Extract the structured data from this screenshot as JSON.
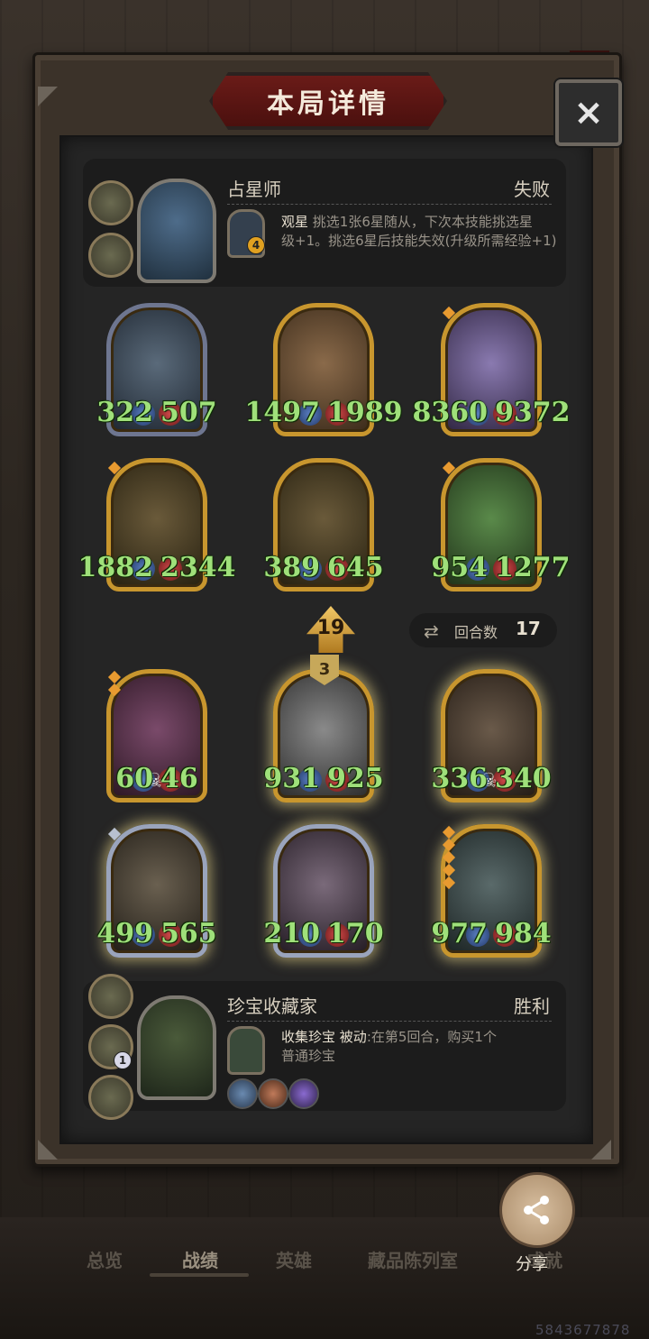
{
  "title": "本局详情",
  "close_icon": "×",
  "top_player": {
    "name": "占星师",
    "result": "失败",
    "skill_badge": "4",
    "skill_name": "观星",
    "skill_desc_1": "挑选1张6星随从，下次本技能挑选星",
    "skill_desc_2": "级+1。挑选6星后技能失效(升级所需经验+1)"
  },
  "top_units": [
    {
      "atk": "322",
      "hp": "507"
    },
    {
      "atk": "1497",
      "hp": "1989"
    },
    {
      "atk": "8360",
      "hp": "9372"
    },
    {
      "atk": "1882",
      "hp": "2344"
    },
    {
      "atk": "389",
      "hp": "645"
    },
    {
      "atk": "954",
      "hp": "1277"
    }
  ],
  "turn_marker": "19",
  "round": {
    "label": "回合数",
    "value": "17"
  },
  "level_badge": "3",
  "bottom_units": [
    {
      "atk": "60",
      "hp": "46"
    },
    {
      "atk": "931",
      "hp": "925"
    },
    {
      "atk": "336",
      "hp": "340"
    },
    {
      "atk": "499",
      "hp": "565"
    },
    {
      "atk": "210",
      "hp": "170"
    },
    {
      "atk": "977",
      "hp": "984"
    }
  ],
  "bottom_player": {
    "name": "珍宝收藏家",
    "result": "胜利",
    "side_badge": "1",
    "skill_name": "收集珍宝",
    "skill_type": "被动",
    "skill_desc_1": ":在第5回合，购买1个",
    "skill_desc_2": "普通珍宝"
  },
  "nav": [
    "总览",
    "战绩",
    "英雄",
    "藏品陈列室",
    "成就"
  ],
  "share_label": "分享",
  "uid": "5843677878",
  "colors": {
    "stat_green": "#9fe07a",
    "gold_frame": "#c8962e",
    "banner_red": "#6a1b18"
  }
}
